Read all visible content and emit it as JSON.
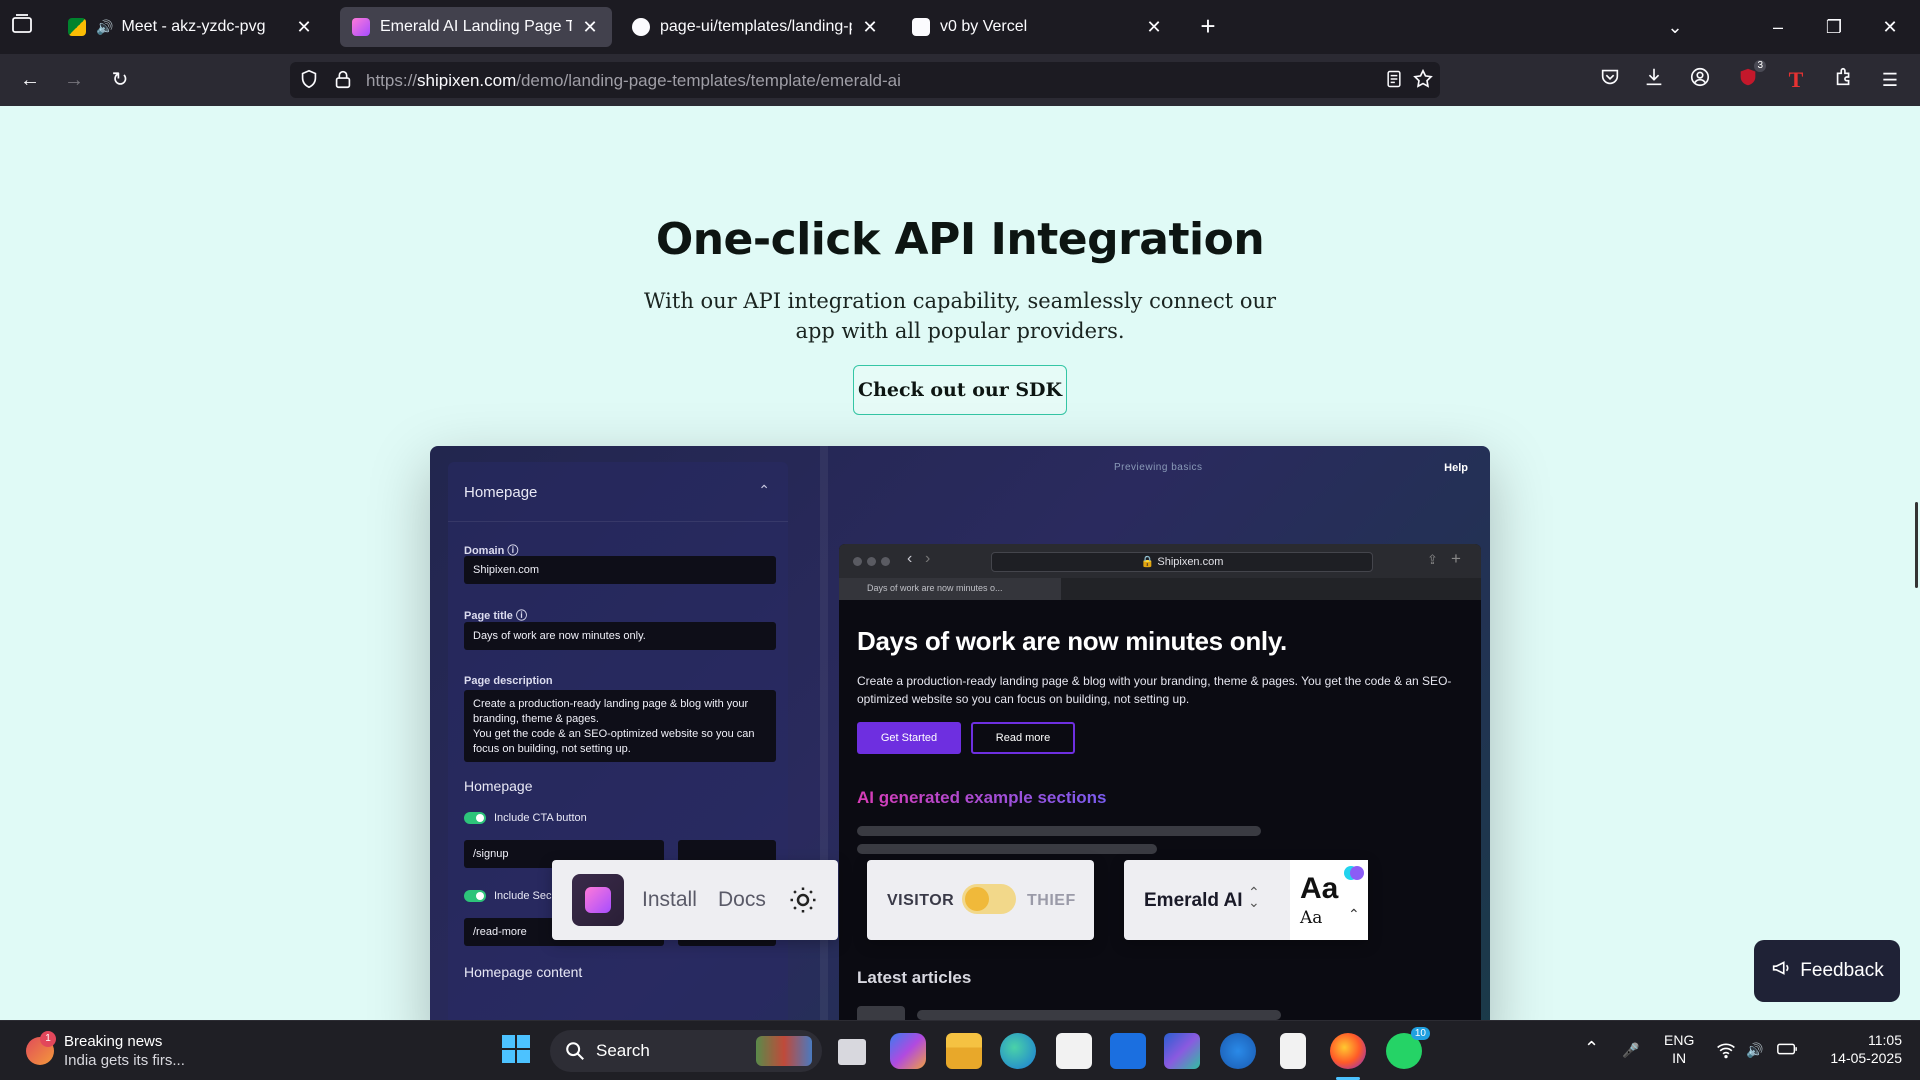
{
  "browser": {
    "tabs": [
      {
        "title": "Meet - akz-yzdc-pvg",
        "active": false,
        "audio": true
      },
      {
        "title": "Emerald AI Landing Page Templ",
        "active": true
      },
      {
        "title": "page-ui/templates/landing-pag",
        "active": false
      },
      {
        "title": "v0 by Vercel",
        "active": false
      }
    ],
    "url_prefix": "https://",
    "url_domain": "shipixen.com",
    "url_path": "/demo/landing-page-templates/template/emerald-ai",
    "extension_badge": "3"
  },
  "page": {
    "title": "One-click API Integration",
    "subtitle": "With our API integration capability, seamlessly connect our app with all popular providers.",
    "sdk_button": "Check out our SDK",
    "feedback_button": "Feedback"
  },
  "editor": {
    "header": "Homepage",
    "domain_label": "Domain",
    "domain_value": "Shipixen.com",
    "page_title_label": "Page title",
    "page_title_value": "Days of work are now minutes only.",
    "page_desc_label": "Page description",
    "page_desc_value": "Create a production-ready landing page & blog with your branding, theme & pages.\nYou get the code & an SEO-optimized website so you can focus on building, not setting up.",
    "section_homepage": "Homepage",
    "include_cta": "Include CTA button",
    "signup_value": "/signup",
    "include_sec": "Include Sec",
    "readmore_value": "/read-more",
    "readmore_label": "Read more",
    "homepage_content": "Homepage content",
    "previewing": "Previewing basics",
    "help": "Help"
  },
  "preview": {
    "url": "Shipixen.com",
    "tab_title": "Days of work are now minutes o...",
    "headline": "Days of work are now minutes only.",
    "body": "Create a production-ready landing page & blog with your branding, theme & pages. You get the code & an SEO-optimized website so you can focus on building, not setting up.",
    "cta_primary": "Get Started",
    "cta_secondary": "Read more",
    "ai_heading": "AI generated example sections",
    "latest_heading": "Latest articles"
  },
  "floating_toolbar": {
    "install": "Install",
    "docs": "Docs",
    "visitor": "VISITOR",
    "thief": "THIEF",
    "theme_name": "Emerald AI",
    "aa_big": "Aa",
    "aa_small": "Aa"
  },
  "taskbar": {
    "news_title": "Breaking news",
    "news_sub": "India gets its firs...",
    "news_badge": "1",
    "search_label": "Search",
    "lang_top": "ENG",
    "lang_bottom": "IN",
    "time": "11:05",
    "date": "14-05-2025",
    "whatsapp_badge": "10"
  },
  "colors": {
    "page_bg": "#e0faf6",
    "accent_teal": "#34c6a5",
    "preview_purple": "#6e2fe0",
    "chrome_dark": "#1c1b22"
  }
}
